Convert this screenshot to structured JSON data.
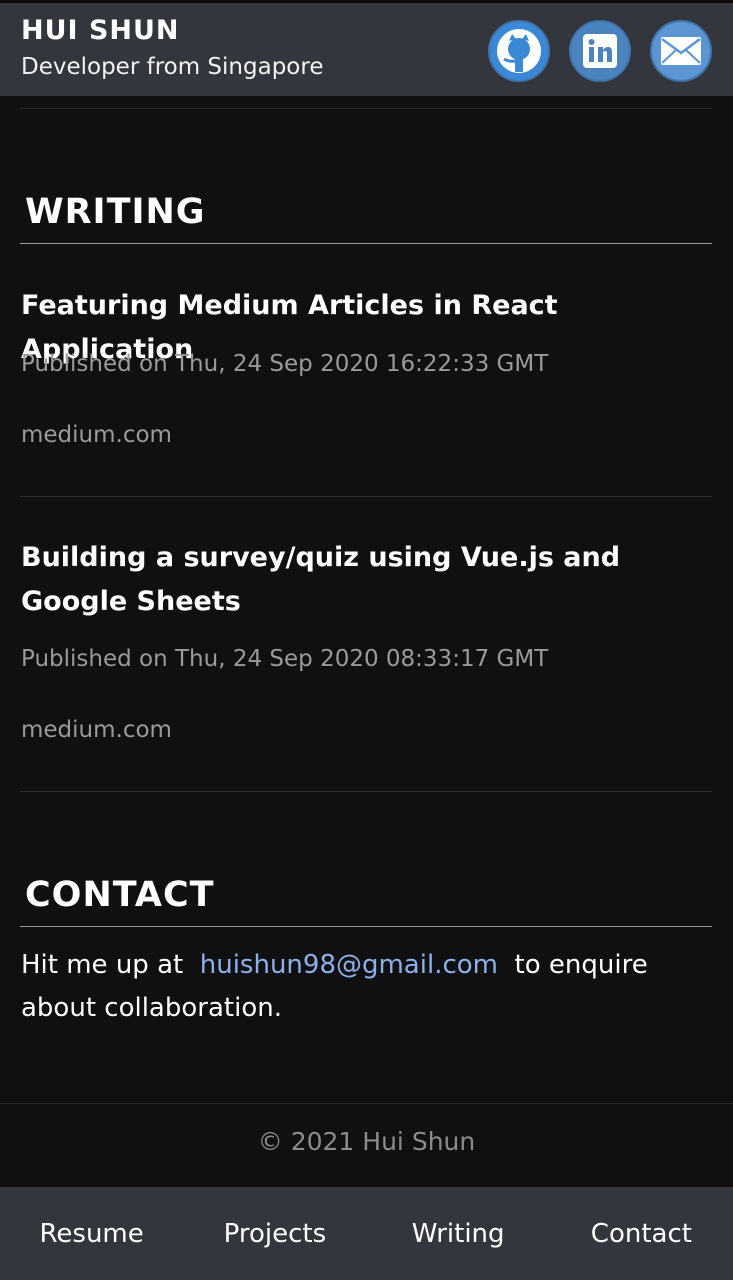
{
  "header": {
    "name": "HUI SHUN",
    "tagline": "Developer from Singapore",
    "social": [
      {
        "icon": "github-icon",
        "label": "GitHub"
      },
      {
        "icon": "linkedin-icon",
        "label": "LinkedIn"
      },
      {
        "icon": "mail-icon",
        "label": "Email"
      }
    ]
  },
  "writing": {
    "title": "WRITING",
    "articles": [
      {
        "title": "Featuring Medium Articles in React Application",
        "date": "Published on Thu, 24 Sep 2020 16:22:33 GMT",
        "source": "medium.com"
      },
      {
        "title": "Building a survey/quiz using Vue.js and Google Sheets",
        "date": "Published on Thu, 24 Sep 2020 08:33:17 GMT",
        "source": "medium.com"
      }
    ]
  },
  "contact": {
    "title": "CONTACT",
    "prefix": "Hit me up at",
    "email": "huishun98@gmail.com",
    "suffix": "to enquire about collaboration."
  },
  "footer": {
    "copyright": "© 2021 Hui Shun"
  },
  "nav": {
    "items": [
      "Resume",
      "Projects",
      "Writing",
      "Contact"
    ]
  },
  "colors": {
    "header_bg": "#33373d",
    "page_bg": "#101012",
    "link": "#8cb0e8",
    "muted": "#9a9a9e"
  }
}
